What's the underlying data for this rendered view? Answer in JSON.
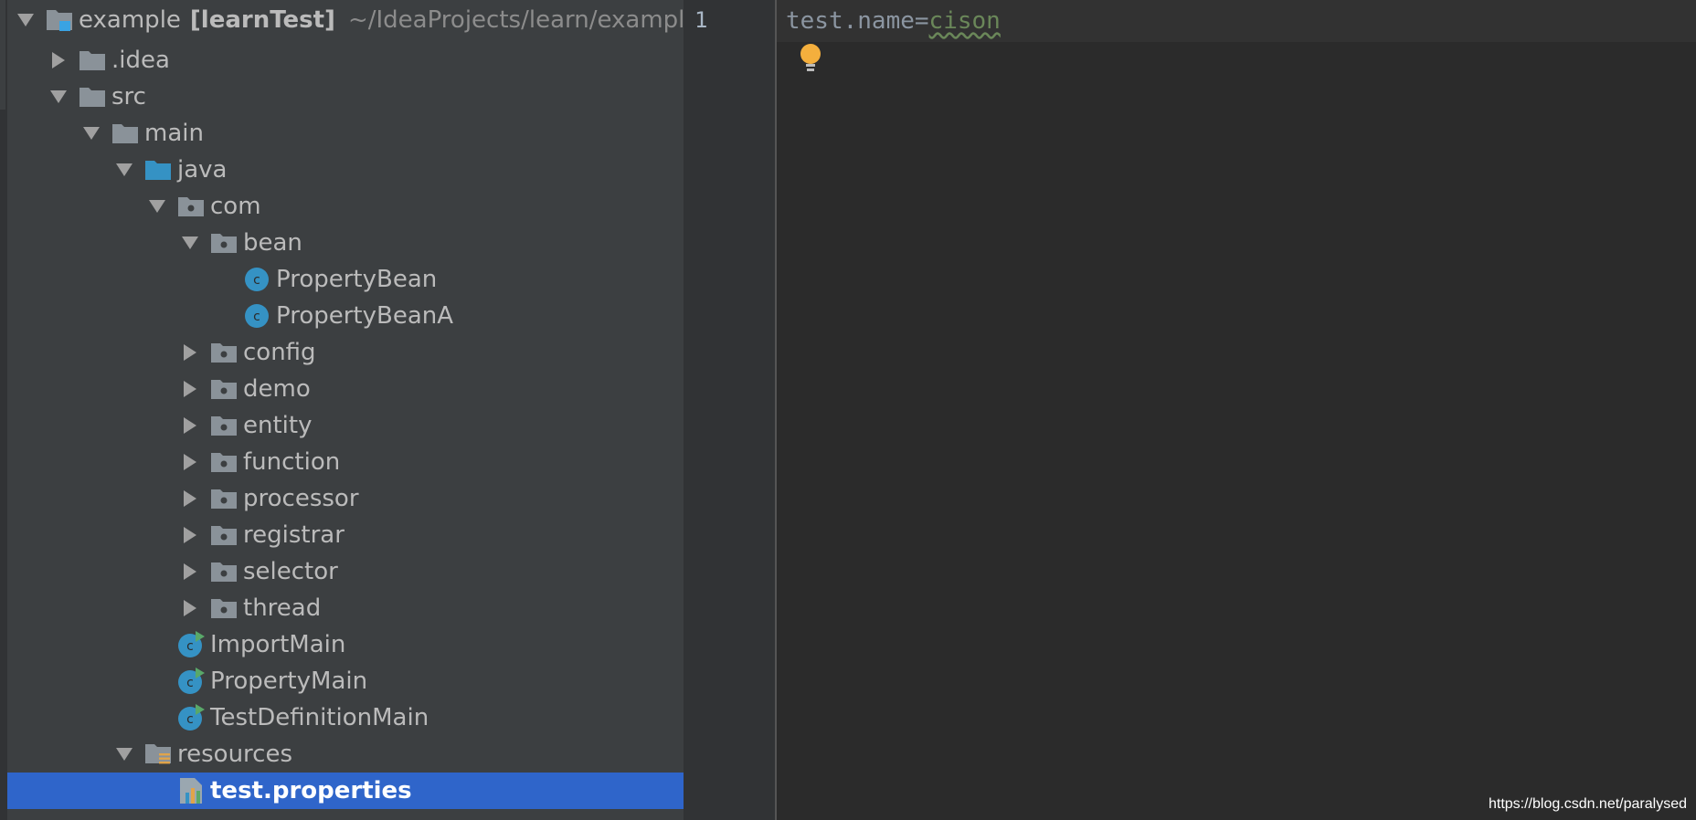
{
  "project_tree": {
    "items": [
      {
        "label": "example",
        "badge": "[learnTest]",
        "hint": "~/IdeaProjects/learn/example",
        "icon": "module-folder-icon",
        "expanded": true
      },
      {
        "label": ".idea",
        "icon": "folder-icon",
        "expanded": false
      },
      {
        "label": "src",
        "icon": "folder-icon",
        "expanded": true
      },
      {
        "label": "main",
        "icon": "folder-icon",
        "expanded": true
      },
      {
        "label": "java",
        "icon": "source-root-folder-icon",
        "expanded": true
      },
      {
        "label": "com",
        "icon": "package-icon",
        "expanded": true
      },
      {
        "label": "bean",
        "icon": "package-icon",
        "expanded": true
      },
      {
        "label": "PropertyBean",
        "icon": "java-class-icon"
      },
      {
        "label": "PropertyBeanA",
        "icon": "java-class-icon"
      },
      {
        "label": "config",
        "icon": "package-icon",
        "expanded": false
      },
      {
        "label": "demo",
        "icon": "package-icon",
        "expanded": false
      },
      {
        "label": "entity",
        "icon": "package-icon",
        "expanded": false
      },
      {
        "label": "function",
        "icon": "package-icon",
        "expanded": false
      },
      {
        "label": "processor",
        "icon": "package-icon",
        "expanded": false
      },
      {
        "label": "registrar",
        "icon": "package-icon",
        "expanded": false
      },
      {
        "label": "selector",
        "icon": "package-icon",
        "expanded": false
      },
      {
        "label": "thread",
        "icon": "package-icon",
        "expanded": false
      },
      {
        "label": "ImportMain",
        "icon": "runnable-class-icon"
      },
      {
        "label": "PropertyMain",
        "icon": "runnable-class-icon"
      },
      {
        "label": "TestDefinitionMain",
        "icon": "runnable-class-icon"
      },
      {
        "label": "resources",
        "icon": "resources-folder-icon",
        "expanded": true
      },
      {
        "label": "test.properties",
        "icon": "properties-file-icon",
        "selected": true
      }
    ]
  },
  "editor": {
    "line_number": "1",
    "code_key": "test.name",
    "code_eq": "=",
    "code_value": "cison"
  },
  "watermark": "https://blog.csdn.net/paralysed",
  "colors": {
    "panel_bg": "#3c3f41",
    "editor_bg": "#2b2b2b",
    "selection": "#2f65ca",
    "class_icon": "#3592c4",
    "run_badge": "#59a869",
    "bulb": "#f4af3d"
  }
}
